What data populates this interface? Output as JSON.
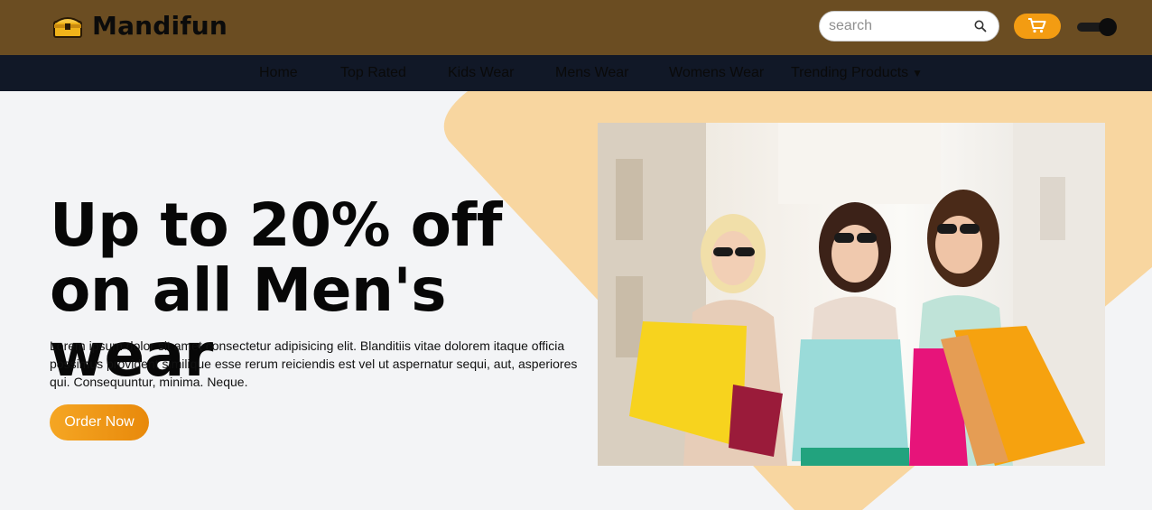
{
  "header": {
    "brand_name": "Mandifun",
    "brand_icon": "treasure-chest-icon",
    "search_placeholder": "search",
    "search_icon": "search-icon",
    "cart_icon": "cart-icon",
    "theme_toggle": "dark-mode-toggle"
  },
  "nav": {
    "items": [
      {
        "label": "Home"
      },
      {
        "label": "Top Rated"
      },
      {
        "label": "Kids Wear"
      },
      {
        "label": "Mens Wear"
      },
      {
        "label": "Womens Wear"
      },
      {
        "label": "Trending Products"
      }
    ],
    "dropdown_icon": "caret-down-icon"
  },
  "hero": {
    "headline": "Up to 20% off on all Men's wear",
    "body": "Lorem ipsum dolor sit amet consectetur adipisicing elit. Blanditiis vitae dolorem itaque officia possimus provident similique esse rerum reiciendis est vel ut aspernatur sequi, aut, asperiores qui. Consequuntur, minima. Neque.",
    "cta_label": "Order Now",
    "image": "three-women-with-shopping-bags"
  },
  "colors": {
    "header_bg": "#6b4d22",
    "nav_bg": "#111827",
    "hero_bg": "#f3f4f6",
    "accent": "#f39c12",
    "shape": "#f8d6a0"
  }
}
